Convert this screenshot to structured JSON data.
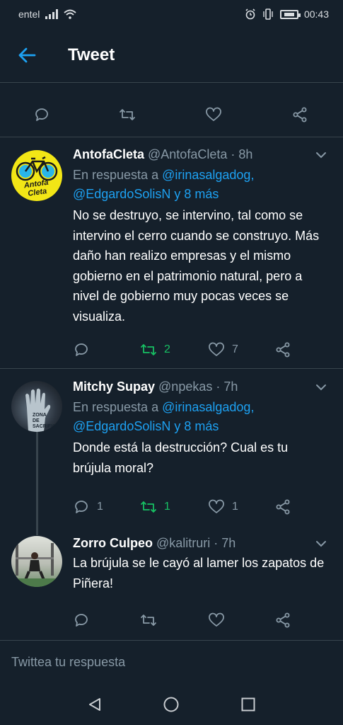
{
  "status_bar": {
    "carrier": "entel",
    "time": "00:43"
  },
  "header": {
    "title": "Tweet"
  },
  "tweets": [
    {
      "name": "AntofaCleta",
      "handle": "@AntofaCleta",
      "time": "8h",
      "reply_prefix": "En respuesta a",
      "reply_user": "@irinasalgadog,",
      "reply_more": "@EdgardoSolisN y 8 más",
      "text": "No se destruyo, se intervino, tal como se intervino el cerro cuando se construyo. Más daño han realizo empresas y el mismo gobierno en el patrimonio natural, pero a nivel de gobierno muy pocas veces se visualiza.",
      "retweets": "2",
      "likes": "7",
      "replies": ""
    },
    {
      "name": "Mitchy Supay",
      "handle": "@npekas",
      "time": "7h",
      "reply_prefix": "En respuesta a",
      "reply_user": "@irinasalgadog,",
      "reply_more": "@EdgardoSolisN y 8 más",
      "text": "Donde está la destrucción? Cual es tu brújula moral?",
      "replies": "1",
      "retweets": "1",
      "likes": "1"
    },
    {
      "name": "Zorro Culpeo",
      "handle": "@kalitruri",
      "time": "7h",
      "text": "La brújula se le cayó al lamer los zapatos de Piñera!",
      "replies": "",
      "retweets": "",
      "likes": ""
    }
  ],
  "composer": {
    "placeholder": "Twittea tu respuesta"
  },
  "avatar_text": {
    "antofacleta_logo": "Antofa Cleta",
    "mitchy_sign": "ZONA DE SACRIFICIO"
  },
  "colors": {
    "background": "#15202b",
    "accent": "#1da1f2",
    "retweet_active": "#17bf63",
    "muted": "#8899a6",
    "divider": "#38444d"
  }
}
